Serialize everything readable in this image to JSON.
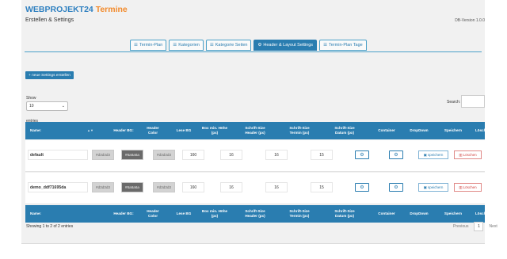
{
  "header": {
    "brand_part1": "WEB",
    "brand_part2": "PROJEKT24",
    "brand_part3": " Termine",
    "subtitle": "Erstellen & Settings",
    "version": "DB-Version 1.0.0"
  },
  "tabs": [
    {
      "label": "Termin-Plan",
      "active": false
    },
    {
      "label": "Kategorien",
      "active": false
    },
    {
      "label": "Kategorie Seiten",
      "active": false
    },
    {
      "label": "Header & Layout Settings",
      "active": true
    },
    {
      "label": "Termin-Plan Tage",
      "active": false
    }
  ],
  "toolbar": {
    "new_label": "+ neue Settings erstellen"
  },
  "table_controls": {
    "show_label": "Show",
    "show_value": "10",
    "entries_label": "entries",
    "search_label": "Search:",
    "search_value": ""
  },
  "columns": [
    "Name:",
    "Header BG:",
    "Header Color",
    "Lese BG",
    "Box min. Höhe (px)",
    "Schrift-Size Header (px)",
    "Schrift-Size Termin (px)",
    "Schrift-Size Datum (px)",
    "Container",
    "DropDown",
    "Speichern",
    "Löschen"
  ],
  "rows": [
    {
      "name": "default",
      "header_bg": "#d3d3d3",
      "header_color": "#6a6a6a",
      "lese_bg": "#d3d3d3",
      "box_height": "160",
      "size_header": "16",
      "size_termin": "16",
      "size_datum": "15"
    },
    {
      "name": "demo_ddf71695da",
      "header_bg": "#d3d3d3",
      "header_color": "#6a6a6a",
      "lese_bg": "#d3d3d3",
      "box_height": "160",
      "size_header": "16",
      "size_termin": "16",
      "size_datum": "15"
    }
  ],
  "actions": {
    "save_label": "speichern",
    "delete_label": "Löschen"
  },
  "footer": {
    "info": "Showing 1 to 2 of 2 entries",
    "prev": "Previous",
    "page": "1",
    "next": "Next"
  },
  "colors": {
    "accent": "#2a7db0",
    "brand_orange": "#f28a2b",
    "danger": "#d14340",
    "swatch_light": "#d3d3d3",
    "swatch_dark": "#6a6a6a"
  },
  "icons": {
    "tab_icon": "list-icon",
    "container_icon": "gears-icon",
    "dropdown_icon": "gears-icon",
    "save_icon": "floppy-icon",
    "delete_icon": "trash-icon",
    "select_icon": "chevron-down-icon"
  }
}
